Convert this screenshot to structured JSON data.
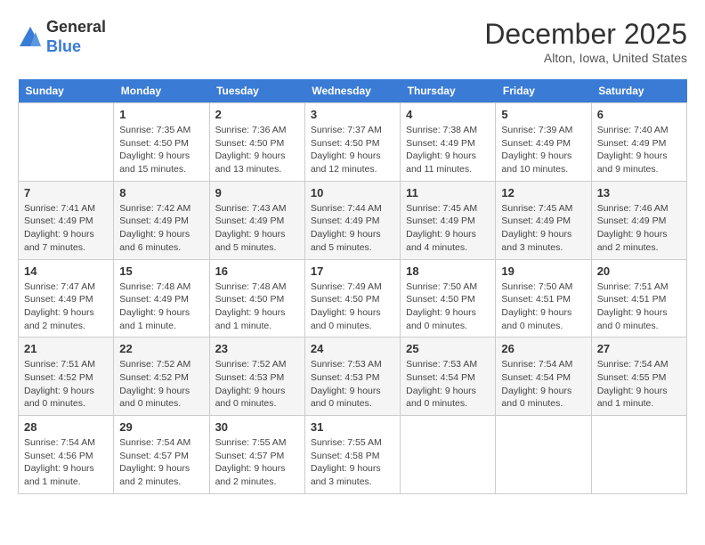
{
  "header": {
    "logo_line1": "General",
    "logo_line2": "Blue",
    "month_title": "December 2025",
    "location": "Alton, Iowa, United States"
  },
  "days_of_week": [
    "Sunday",
    "Monday",
    "Tuesday",
    "Wednesday",
    "Thursday",
    "Friday",
    "Saturday"
  ],
  "weeks": [
    [
      {
        "day": "",
        "info": ""
      },
      {
        "day": "1",
        "info": "Sunrise: 7:35 AM\nSunset: 4:50 PM\nDaylight: 9 hours\nand 15 minutes."
      },
      {
        "day": "2",
        "info": "Sunrise: 7:36 AM\nSunset: 4:50 PM\nDaylight: 9 hours\nand 13 minutes."
      },
      {
        "day": "3",
        "info": "Sunrise: 7:37 AM\nSunset: 4:50 PM\nDaylight: 9 hours\nand 12 minutes."
      },
      {
        "day": "4",
        "info": "Sunrise: 7:38 AM\nSunset: 4:49 PM\nDaylight: 9 hours\nand 11 minutes."
      },
      {
        "day": "5",
        "info": "Sunrise: 7:39 AM\nSunset: 4:49 PM\nDaylight: 9 hours\nand 10 minutes."
      },
      {
        "day": "6",
        "info": "Sunrise: 7:40 AM\nSunset: 4:49 PM\nDaylight: 9 hours\nand 9 minutes."
      }
    ],
    [
      {
        "day": "7",
        "info": "Sunrise: 7:41 AM\nSunset: 4:49 PM\nDaylight: 9 hours\nand 7 minutes."
      },
      {
        "day": "8",
        "info": "Sunrise: 7:42 AM\nSunset: 4:49 PM\nDaylight: 9 hours\nand 6 minutes."
      },
      {
        "day": "9",
        "info": "Sunrise: 7:43 AM\nSunset: 4:49 PM\nDaylight: 9 hours\nand 5 minutes."
      },
      {
        "day": "10",
        "info": "Sunrise: 7:44 AM\nSunset: 4:49 PM\nDaylight: 9 hours\nand 5 minutes."
      },
      {
        "day": "11",
        "info": "Sunrise: 7:45 AM\nSunset: 4:49 PM\nDaylight: 9 hours\nand 4 minutes."
      },
      {
        "day": "12",
        "info": "Sunrise: 7:45 AM\nSunset: 4:49 PM\nDaylight: 9 hours\nand 3 minutes."
      },
      {
        "day": "13",
        "info": "Sunrise: 7:46 AM\nSunset: 4:49 PM\nDaylight: 9 hours\nand 2 minutes."
      }
    ],
    [
      {
        "day": "14",
        "info": "Sunrise: 7:47 AM\nSunset: 4:49 PM\nDaylight: 9 hours\nand 2 minutes."
      },
      {
        "day": "15",
        "info": "Sunrise: 7:48 AM\nSunset: 4:49 PM\nDaylight: 9 hours\nand 1 minute."
      },
      {
        "day": "16",
        "info": "Sunrise: 7:48 AM\nSunset: 4:50 PM\nDaylight: 9 hours\nand 1 minute."
      },
      {
        "day": "17",
        "info": "Sunrise: 7:49 AM\nSunset: 4:50 PM\nDaylight: 9 hours\nand 0 minutes."
      },
      {
        "day": "18",
        "info": "Sunrise: 7:50 AM\nSunset: 4:50 PM\nDaylight: 9 hours\nand 0 minutes."
      },
      {
        "day": "19",
        "info": "Sunrise: 7:50 AM\nSunset: 4:51 PM\nDaylight: 9 hours\nand 0 minutes."
      },
      {
        "day": "20",
        "info": "Sunrise: 7:51 AM\nSunset: 4:51 PM\nDaylight: 9 hours\nand 0 minutes."
      }
    ],
    [
      {
        "day": "21",
        "info": "Sunrise: 7:51 AM\nSunset: 4:52 PM\nDaylight: 9 hours\nand 0 minutes."
      },
      {
        "day": "22",
        "info": "Sunrise: 7:52 AM\nSunset: 4:52 PM\nDaylight: 9 hours\nand 0 minutes."
      },
      {
        "day": "23",
        "info": "Sunrise: 7:52 AM\nSunset: 4:53 PM\nDaylight: 9 hours\nand 0 minutes."
      },
      {
        "day": "24",
        "info": "Sunrise: 7:53 AM\nSunset: 4:53 PM\nDaylight: 9 hours\nand 0 minutes."
      },
      {
        "day": "25",
        "info": "Sunrise: 7:53 AM\nSunset: 4:54 PM\nDaylight: 9 hours\nand 0 minutes."
      },
      {
        "day": "26",
        "info": "Sunrise: 7:54 AM\nSunset: 4:54 PM\nDaylight: 9 hours\nand 0 minutes."
      },
      {
        "day": "27",
        "info": "Sunrise: 7:54 AM\nSunset: 4:55 PM\nDaylight: 9 hours\nand 1 minute."
      }
    ],
    [
      {
        "day": "28",
        "info": "Sunrise: 7:54 AM\nSunset: 4:56 PM\nDaylight: 9 hours\nand 1 minute."
      },
      {
        "day": "29",
        "info": "Sunrise: 7:54 AM\nSunset: 4:57 PM\nDaylight: 9 hours\nand 2 minutes."
      },
      {
        "day": "30",
        "info": "Sunrise: 7:55 AM\nSunset: 4:57 PM\nDaylight: 9 hours\nand 2 minutes."
      },
      {
        "day": "31",
        "info": "Sunrise: 7:55 AM\nSunset: 4:58 PM\nDaylight: 9 hours\nand 3 minutes."
      },
      {
        "day": "",
        "info": ""
      },
      {
        "day": "",
        "info": ""
      },
      {
        "day": "",
        "info": ""
      }
    ]
  ]
}
